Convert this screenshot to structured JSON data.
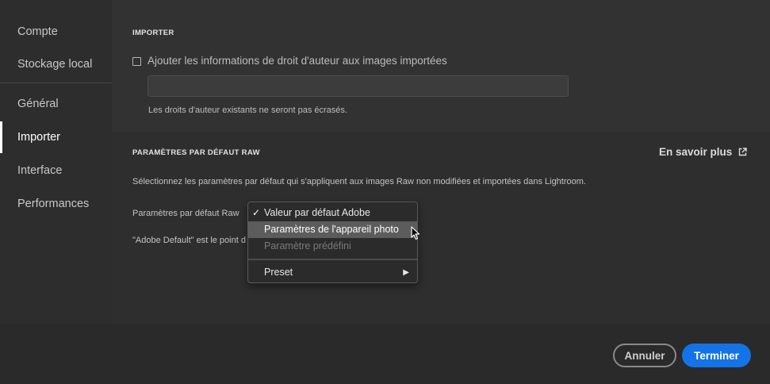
{
  "sidebar": {
    "items": [
      {
        "label": "Compte"
      },
      {
        "label": "Stockage local"
      },
      {
        "label": "Général"
      },
      {
        "label": "Importer",
        "active": true
      },
      {
        "label": "Interface"
      },
      {
        "label": "Performances"
      }
    ]
  },
  "import_section": {
    "title": "IMPORTER",
    "checkbox_label": "Ajouter les informations de droit d'auteur aux images importées",
    "checkbox_checked": false,
    "copyright_value": "",
    "note": "Les droits d'auteur existants ne seront pas écrasés."
  },
  "raw_section": {
    "title": "PARAMÈTRES PAR DÉFAUT RAW",
    "learn_more": "En savoir plus",
    "description": "Sélectionnez les paramètres par défaut qui s'appliquent aux images Raw non modifiées et importées dans Lightroom.",
    "defaults_label": "Paramètres par défaut Raw",
    "defaults_note": "\"Adobe Default\" est le point d"
  },
  "dropdown_menu": {
    "items": [
      {
        "label": "Valeur par défaut Adobe",
        "checked": true
      },
      {
        "label": "Paramètres de l'appareil photo",
        "highlighted": true
      },
      {
        "label": "Paramètre prédéfini",
        "disabled": true
      },
      {
        "label": "Preset",
        "submenu": true
      }
    ],
    "check_glyph": "✓",
    "submenu_glyph": "▶"
  },
  "footer": {
    "cancel_label": "Annuler",
    "done_label": "Terminer"
  },
  "colors": {
    "accent": "#1473e6",
    "background": "#2a2a2a",
    "menu_highlight": "#5c5c5c"
  },
  "icons": {
    "external_link": "external-link-icon",
    "pointer": "mouse-pointer-icon"
  }
}
